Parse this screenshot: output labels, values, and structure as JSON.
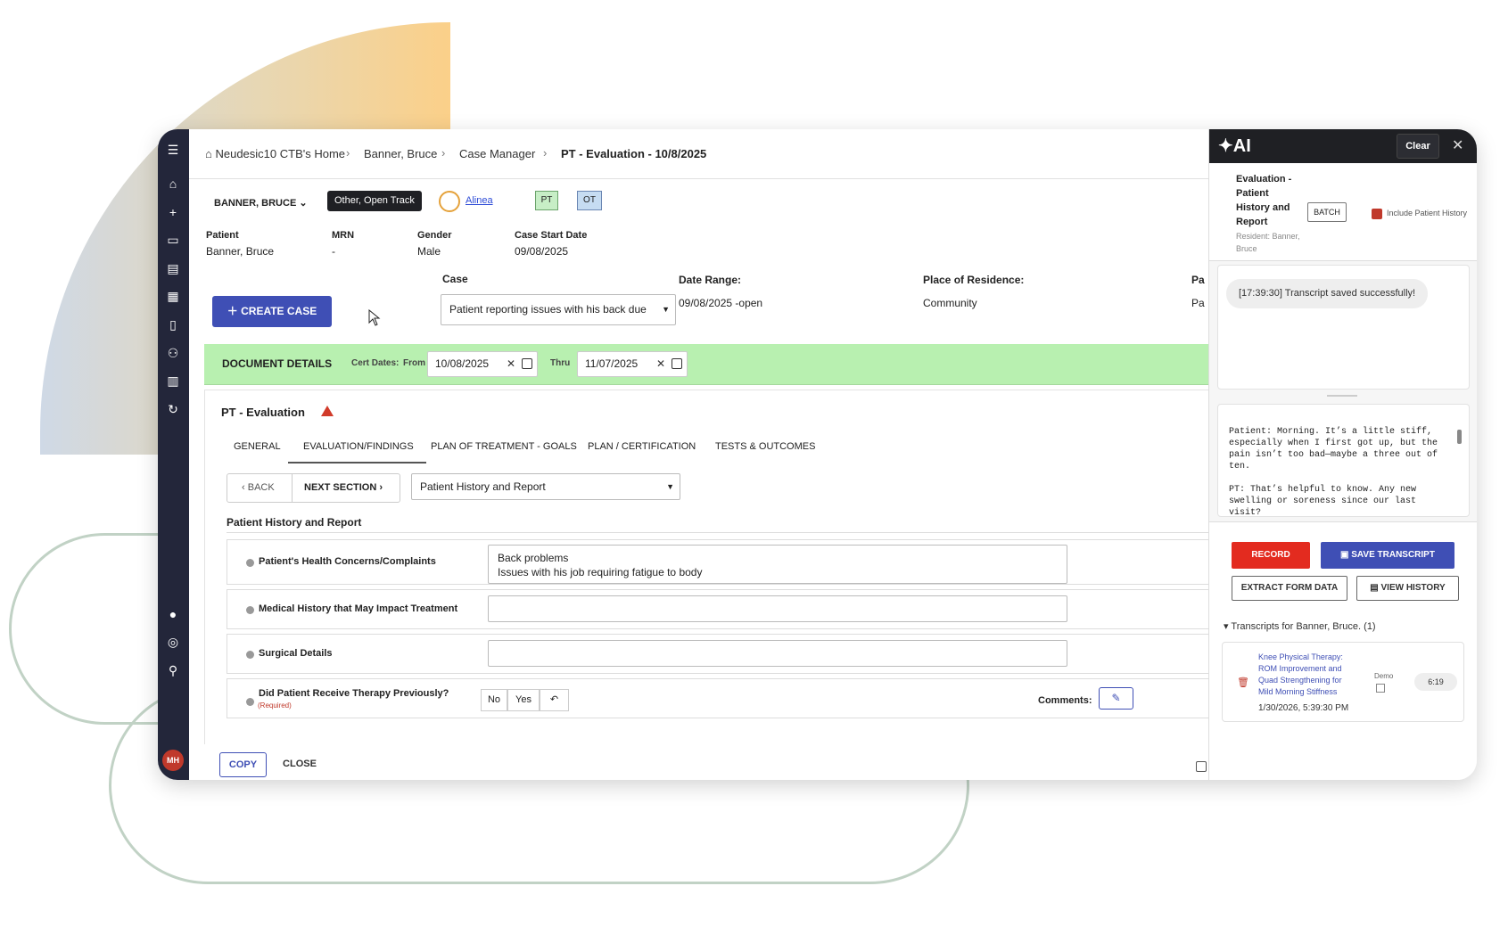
{
  "breadcrumbs": [
    "Neudesic10 CTB's Home",
    "Banner, Bruce",
    "Case Manager",
    "PT - Evaluation - 10/8/2025"
  ],
  "patient": {
    "selector_name": "BANNER, BRUCE",
    "track_tag": "Other, Open Track",
    "alinea_link": "Alinea",
    "tag_pt": "PT",
    "tag_ot": "OT",
    "fields": [
      {
        "label": "Patient",
        "value": "Banner, Bruce"
      },
      {
        "label": "MRN",
        "value": "-"
      },
      {
        "label": "Gender",
        "value": "Male"
      },
      {
        "label": "Case Start Date",
        "value": "09/08/2025"
      }
    ]
  },
  "case": {
    "create_button": "CREATE CASE",
    "case_label": "Case",
    "case_value": "Patient reporting issues with his back due",
    "date_range_label": "Date Range:",
    "date_range_value": "09/08/2025 -open",
    "residence_label": "Place of Residence:",
    "residence_value": "Community",
    "extra_label": "Pa",
    "extra_value": "Pa"
  },
  "document_details": {
    "title": "DOCUMENT DETAILS",
    "cert_dates": "Cert Dates:",
    "from_label": "From",
    "from_value": "10/08/2025",
    "thru_label": "Thru",
    "thru_value": "11/07/2025"
  },
  "document": {
    "title": "PT - Evaluation",
    "tabs": [
      "GENERAL",
      "EVALUATION/FINDINGS",
      "PLAN OF TREATMENT - GOALS",
      "PLAN / CERTIFICATION",
      "TESTS & OUTCOMES"
    ],
    "active_tab": "EVALUATION/FINDINGS",
    "back": "BACK",
    "next": "NEXT SECTION",
    "section_select": "Patient History and Report",
    "section_title": "Patient History and Report",
    "questions": [
      {
        "label": "Patient's Health Concerns/Complaints",
        "value": "Back problems\nIssues with his job requiring fatigue to body"
      },
      {
        "label": "Medical History that May Impact Treatment",
        "value": ""
      },
      {
        "label": "Surgical Details",
        "value": ""
      },
      {
        "label": "Did Patient Receive Therapy Previously?",
        "value": ""
      }
    ],
    "required": "(Required)",
    "no": "No",
    "yes": "Yes",
    "comments_label": "Comments:",
    "copy": "COPY",
    "close": "CLOSE"
  },
  "ai": {
    "logo": "✦AI",
    "clear": "Clear",
    "context_title": "Evaluation - Patient History and Report",
    "context_sub": "Resident: Banner, Bruce",
    "batch": "BATCH",
    "include_history": "Include Patient History",
    "message": "[17:39:30] Transcript saved successfully!",
    "transcript": "Patient: Morning. It’s a little stiff, especially when I first got up, but the pain isn’t too bad—maybe a three out of ten.\n\nPT: That’s helpful to know. Any new swelling or soreness since our last visit?",
    "record": "RECORD",
    "save_transcript": "SAVE TRANSCRIPT",
    "extract": "EXTRACT FORM DATA",
    "view_history": "VIEW HISTORY",
    "transcripts_header": "Transcripts for Banner, Bruce. (1)",
    "transcript_item": {
      "title": "Knee Physical Therapy: ROM Improvement and Quad Strengthening for Mild Morning Stiffness",
      "date": "1/30/2026, 5:39:30 PM",
      "demo": "Demo",
      "duration": "6:19"
    }
  },
  "rail": {
    "avatar": "MH"
  }
}
